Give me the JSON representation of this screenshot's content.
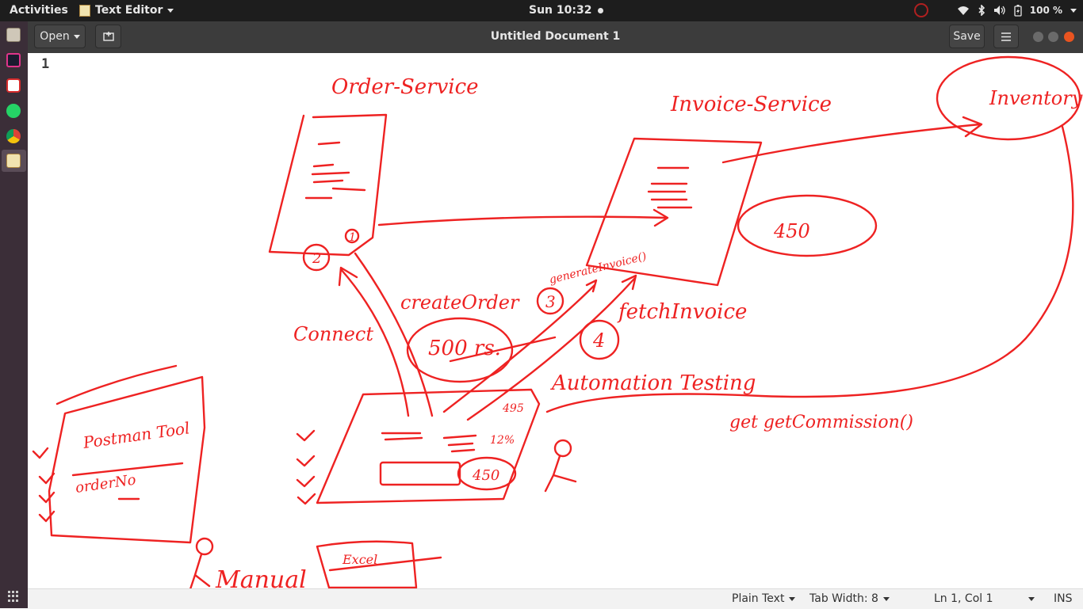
{
  "topbar": {
    "activities": "Activities",
    "app_name": "Text Editor",
    "clock": "Sun 10:32",
    "battery": "100 %"
  },
  "headerbar": {
    "open_label": "Open",
    "title": "Untitled Document 1",
    "save_label": "Save"
  },
  "editor": {
    "line_numbers": [
      "1"
    ]
  },
  "drawing": {
    "ink_color": "#ee2222",
    "labels": {
      "order_service": "Order-Service",
      "invoice_service": "Invoice-Service",
      "inventory": "Inventory",
      "create_order": "createOrder",
      "generate_invoice": "generateInvoice()",
      "fetch_invoice": "fetchInvoice",
      "amount_500": "500 rs.",
      "amount_450": "450",
      "automation_testing": "Automation Testing",
      "connect": "Connect",
      "postman_tool": "Postman Tool",
      "order_no": "orderNo",
      "get_commission": "get getCommission()",
      "manual": "Manual",
      "excel": "Excel",
      "num_1": "1",
      "num_2": "2",
      "num_3": "3",
      "num_4": "4",
      "pct_12": "12%",
      "amount_495": "495",
      "amount_450b": "450"
    }
  },
  "statusbar": {
    "language": "Plain Text",
    "tab_width": "Tab Width: 8",
    "position": "Ln 1, Col 1",
    "mode": "INS"
  },
  "colors": {
    "topbar_bg": "#1d1d1d",
    "dock_bg": "#3b2e38",
    "headerbar_bg": "#3c3c3c",
    "ink": "#ee2222"
  }
}
